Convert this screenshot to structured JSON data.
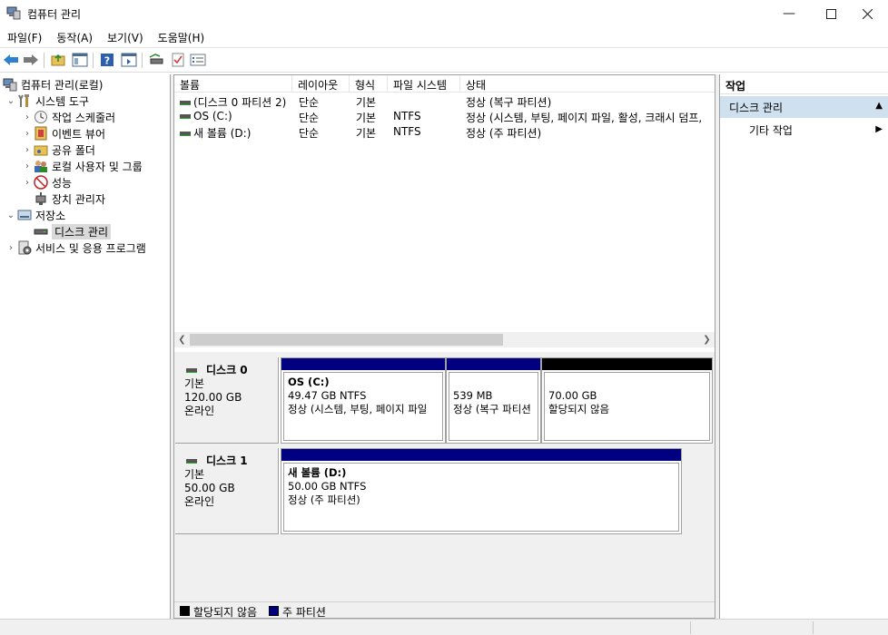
{
  "window": {
    "title": "컴퓨터 관리"
  },
  "menu": [
    "파일(F)",
    "동작(A)",
    "보기(V)",
    "도움말(H)"
  ],
  "tree": {
    "root": "컴퓨터 관리(로컬)",
    "system_tools": "시스템 도구",
    "task_scheduler": "작업 스케줄러",
    "event_viewer": "이벤트 뷰어",
    "shared_folders": "공유 폴더",
    "local_users": "로컬 사용자 및 그룹",
    "performance": "성능",
    "device_manager": "장치 관리자",
    "storage": "저장소",
    "disk_management": "디스크 관리",
    "services": "서비스 및 응용 프로그램"
  },
  "volume_list": {
    "columns": [
      "볼륨",
      "레이아웃",
      "형식",
      "파일 시스템",
      "상태"
    ],
    "rows": [
      [
        "(디스크 0 파티션 2)",
        "단순",
        "기본",
        "",
        "정상 (복구 파티션)"
      ],
      [
        "OS (C:)",
        "단순",
        "기본",
        "NTFS",
        "정상 (시스템, 부팅, 페이지 파일, 활성, 크래시 덤프,"
      ],
      [
        "새 볼륨 (D:)",
        "단순",
        "기본",
        "NTFS",
        "정상 (주 파티션)"
      ]
    ]
  },
  "disks": [
    {
      "name": "디스크 0",
      "type": "기본",
      "size": "120.00 GB",
      "status": "온라인",
      "partitions": [
        {
          "title": "OS  (C:)",
          "size": "49.47 GB NTFS",
          "status": "정상 (시스템, 부팅, 페이지 파일"
        },
        {
          "title": "",
          "size": "539 MB",
          "status": "정상 (복구 파티션"
        },
        {
          "title": "",
          "size": "70.00 GB",
          "status": "할당되지 않음"
        }
      ]
    },
    {
      "name": "디스크 1",
      "type": "기본",
      "size": "50.00 GB",
      "status": "온라인",
      "partitions": [
        {
          "title": "새 볼륨  (D:)",
          "size": "50.00 GB NTFS",
          "status": "정상 (주 파티션)"
        }
      ]
    }
  ],
  "legend": {
    "unallocated": "할당되지 않음",
    "primary": "주 파티션"
  },
  "colors": {
    "primary": "#000080",
    "unallocated": "#000000",
    "action_section": "#cfe0ef"
  },
  "actions": {
    "title": "작업",
    "section": "디스크 관리",
    "more": "기타 작업"
  }
}
